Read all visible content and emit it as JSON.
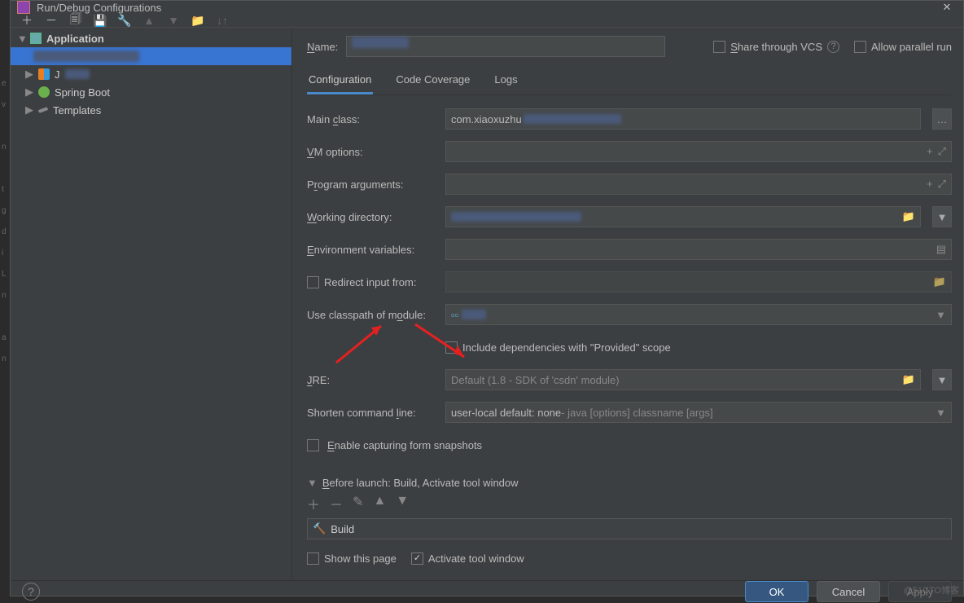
{
  "window": {
    "title": "Run/Debug Configurations"
  },
  "tree": {
    "root": "Application",
    "items": [
      "",
      "J",
      "Spring Boot",
      "Templates"
    ],
    "selected_index": 0
  },
  "name": {
    "label_prefix": "N",
    "label": "ame:",
    "value": ""
  },
  "options": {
    "share_prefix": "S",
    "share": "hare through VCS",
    "allow": "Allow parallel run"
  },
  "tabs": [
    "Configuration",
    "Code Coverage",
    "Logs"
  ],
  "config": {
    "main_class": {
      "label": "Main class:",
      "u": "c",
      "value": "com.xiaoxuzhu"
    },
    "vm_options": {
      "label": "M options:",
      "u": "V"
    },
    "prog_args": {
      "label": "Program arguments:",
      "u": "r"
    },
    "work_dir": {
      "label": "orking directory:",
      "u": "W",
      "value": ""
    },
    "env": {
      "label": "nvironment variables:",
      "u": "E"
    },
    "redirect": {
      "label": "Redirect input from:"
    },
    "classpath": {
      "label": "Use classpath of module:",
      "u": "o",
      "value": ""
    },
    "include_provided": "Include dependencies with \"Provided\" scope",
    "jre": {
      "label": "RE:",
      "u": "J",
      "value": "Default",
      "hint": "(1.8 - SDK of 'csdn' module)"
    },
    "shorten": {
      "label": "Shorten command line:",
      "u": "l",
      "value": "user-local default: none",
      "hint": " - java [options] classname [args]"
    },
    "snapshots": {
      "label": "nable capturing form snapshots",
      "u": "E"
    }
  },
  "before_launch": {
    "label": "efore launch: Build, Activate tool window",
    "u": "B",
    "items": [
      "Build"
    ],
    "show_page": "Show this page",
    "activate": "Activate tool window"
  },
  "buttons": {
    "ok": "OK",
    "cancel": "Cancel",
    "apply": "Apply"
  },
  "watermark": "@51CTO博客"
}
